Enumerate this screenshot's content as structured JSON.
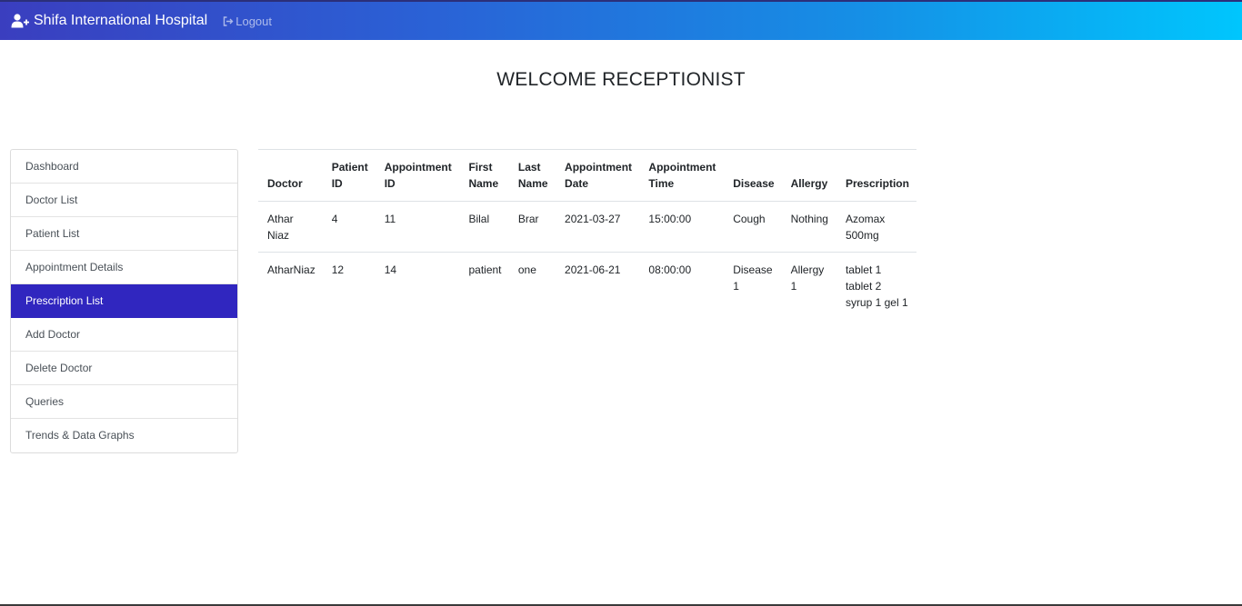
{
  "navbar": {
    "brand": "Shifa International Hospital",
    "brand_icon": "user-plus-icon",
    "logout_label": "Logout",
    "logout_icon": "sign-out-icon",
    "gradient_colors": [
      "#3a3ebf",
      "#00c6fd"
    ]
  },
  "welcome_title": "WELCOME RECEPTIONIST",
  "sidebar": {
    "active_color": "#3026bf",
    "items": [
      {
        "label": "Dashboard"
      },
      {
        "label": "Doctor List"
      },
      {
        "label": "Patient List"
      },
      {
        "label": "Appointment Details"
      },
      {
        "label": "Prescription List"
      },
      {
        "label": "Add Doctor"
      },
      {
        "label": "Delete Doctor"
      },
      {
        "label": "Queries"
      },
      {
        "label": "Trends & Data Graphs"
      }
    ],
    "active_index": 4
  },
  "table": {
    "headers": [
      "Doctor",
      "Patient ID",
      "Appointment ID",
      "First Name",
      "Last Name",
      "Appointment Date",
      "Appointment Time",
      "Disease",
      "Allergy",
      "Prescription"
    ],
    "rows": [
      [
        "Athar Niaz",
        "4",
        "11",
        "Bilal",
        "Brar",
        "2021-03-27",
        "15:00:00",
        "Cough",
        "Nothing",
        "Azomax 500mg"
      ],
      [
        "AtharNiaz",
        "12",
        "14",
        "patient",
        "one",
        "2021-06-21",
        "08:00:00",
        "Disease 1",
        "Allergy 1",
        "tablet 1 tablet 2 syrup 1 gel 1"
      ]
    ]
  }
}
